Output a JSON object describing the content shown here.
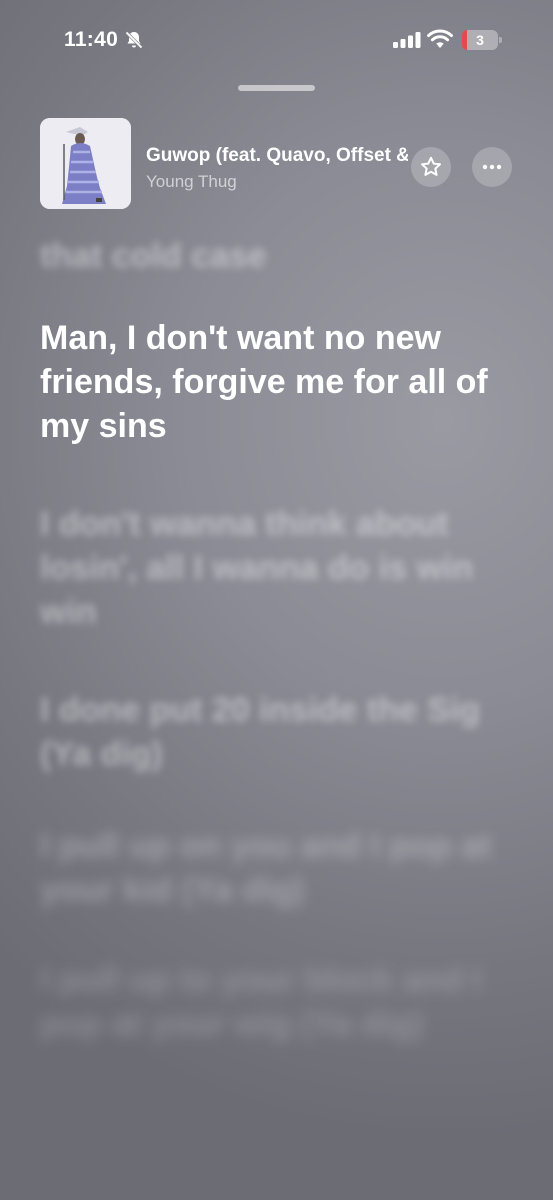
{
  "status_bar": {
    "time": "11:40",
    "battery_level": "3"
  },
  "now_playing": {
    "title": "Guwop (feat. Quavo, Offset & Young Scooter)",
    "artist": "Young Thug"
  },
  "lyrics": {
    "previous": "that cold case",
    "current": "Man, I don't want no new friends, forgive me for all of my sins",
    "upcoming": [
      "I don't wanna think about losin', all I wanna do is win win",
      "I done put 20 inside the Sig (Ya dig)",
      "I pull up on you and I pop at your kid (Ya dig)",
      "I pull up to your block and I pop at your wig (Ya dig)"
    ]
  },
  "icons": [
    "bell-slash-icon",
    "cellular-signal-icon",
    "wifi-icon",
    "battery-icon",
    "star-icon",
    "ellipsis-icon"
  ]
}
